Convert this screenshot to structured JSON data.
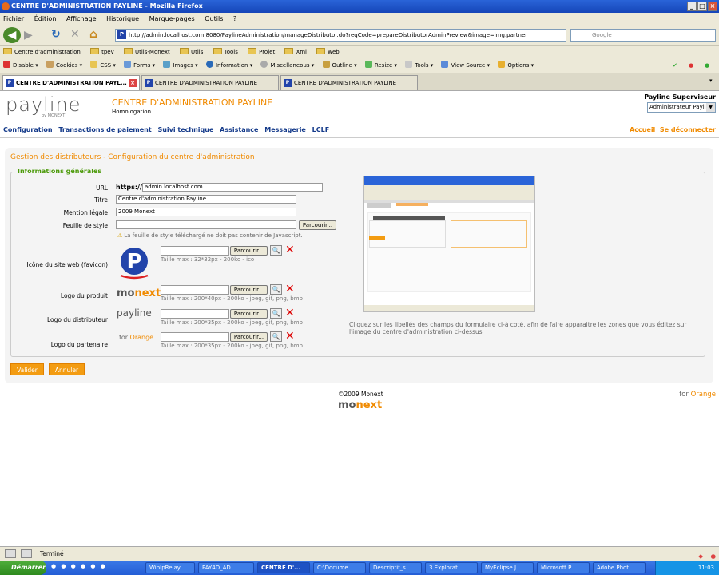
{
  "window": {
    "title": "CENTRE D'ADMINISTRATION PAYLINE - Mozilla Firefox"
  },
  "menubar": [
    "Fichier",
    "Édition",
    "Affichage",
    "Historique",
    "Marque-pages",
    "Outils",
    "?"
  ],
  "navbar": {
    "url": "http://admin.localhost.com:8080/PaylineAdministration/manageDistributor.do?reqCode=prepareDistributorAdminPreview&image=img.partner",
    "search_placeholder": "Google"
  },
  "bookmarks": [
    "Centre d'administration",
    "tpev",
    "Utils-Monext",
    "Utils",
    "Tools",
    "Projet",
    "Xml",
    "web"
  ],
  "devtoolbar": [
    "Disable",
    "Cookies",
    "CSS",
    "Forms",
    "Images",
    "Information",
    "Miscellaneous",
    "Outline",
    "Resize",
    "Tools",
    "View Source",
    "Options"
  ],
  "tabs": [
    {
      "label": "CENTRE D'ADMINISTRATION PAYL..."
    },
    {
      "label": "CENTRE D'ADMINISTRATION PAYLINE"
    },
    {
      "label": "CENTRE D'ADMINISTRATION PAYLINE"
    }
  ],
  "header": {
    "logo": "payline",
    "logo_sub": "by MONEXT",
    "title": "CENTRE D'ADMINISTRATION PAYLINE",
    "subtitle": "Homologation",
    "user_role_label": "Payline Superviseur",
    "user_role_select": "Administrateur Payline"
  },
  "mainmenu": [
    "Configuration",
    "Transactions de paiement",
    "Suivi technique",
    "Assistance",
    "Messagerie",
    "LCLF"
  ],
  "rightlinks": {
    "home": "Accueil",
    "logout": "Se déconnecter"
  },
  "page": {
    "section_title": "Gestion des distributeurs - Configuration du centre d'administration",
    "legend": "Informations générales",
    "fields": {
      "url_label": "URL",
      "url_prefix": "https://",
      "url_value": "admin.localhost.com",
      "title_label": "Titre",
      "title_value": "Centre d'administration Payline",
      "legal_label": "Mention légale",
      "legal_value": "2009 Monext",
      "style_label": "Feuille de style",
      "style_warning": "La feuille de style téléchargé ne doit pas contenir de Javascript.",
      "favicon_label": "Icône du site web (favicon)",
      "favicon_hint": "Taille max : 32*32px - 200ko - ico",
      "product_logo_label": "Logo du produit",
      "product_logo_hint": "Taille max : 200*40px - 200ko - jpeg, gif, png, bmp",
      "distributor_logo_label": "Logo du distributeur",
      "distributor_logo_hint": "Taille max : 200*35px - 200ko - jpeg, gif, png, bmp",
      "partner_logo_label": "Logo du partenaire",
      "partner_logo_hint": "Taille max : 200*35px - 200ko - jpeg, gif, png, bmp"
    },
    "browse_label": "Parcourir...",
    "logo_samples": {
      "monext": "mo",
      "monext_b": "next",
      "payline": "payline",
      "partner_for": "for",
      "partner_name": "Orange"
    },
    "preview_caption": "Cliquez sur les libellés des champs du formulaire ci-à coté, afin de faire apparaitre les zones que vous éditez sur l'image du centre d'administration ci-dessus",
    "buttons": {
      "submit": "Valider",
      "cancel": "Annuler"
    }
  },
  "footer": {
    "copyright": "©2009 Monext",
    "brand_for": "for",
    "brand_name": "Orange"
  },
  "statusbar": {
    "text": "Terminé"
  },
  "taskbar": {
    "start": "Démarrer",
    "tasks": [
      "WinIpRelay",
      "PAY4D_AD...",
      "CENTRE D'...",
      "C:\\Docume...",
      "Descriptif_s...",
      "3 Explorat...",
      "MyEclipse J...",
      "Microsoft P...",
      "Adobe Phot..."
    ],
    "clock": "11:03"
  },
  "colors": {
    "accent": "#f08a00",
    "nav": "#143a8a",
    "legend": "#4c9a0a"
  }
}
